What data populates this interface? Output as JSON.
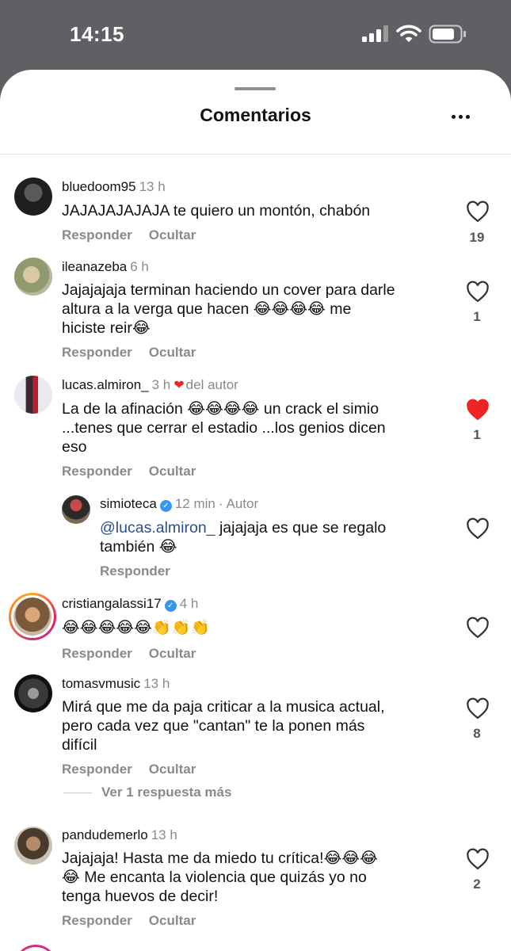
{
  "status_bar": {
    "time": "14:15"
  },
  "sheet": {
    "title": "Comentarios"
  },
  "labels": {
    "reply": "Responder",
    "hide": "Ocultar",
    "by_author": "del autor",
    "author_badge": "Autor"
  },
  "comments": [
    {
      "username": "bluedoom95",
      "time": "13 h",
      "lines": [
        "JAJAJAJAJAJA te quiero un montón, chabón"
      ],
      "likes": "19",
      "liked": false
    },
    {
      "username": "ileanazeba",
      "time": "6 h",
      "lines": [
        "Jajajajaja terminan haciendo un cover para darle",
        "altura a la verga que hacen 😂😂😂😂 me",
        "hiciste reir😂"
      ],
      "likes": "1",
      "liked": false
    },
    {
      "username": "lucas.almiron_",
      "time": "3 h",
      "lines": [
        "La de la afinación 😂😂😂😂 un crack el simio",
        "...tenes que cerrar el estadio ...los genios dicen",
        "eso"
      ],
      "likes": "1",
      "liked": true
    },
    {
      "username": "cristiangalassi17",
      "time": "4 h",
      "lines": [
        "😂😂😂😂😂👏👏👏"
      ],
      "likes": "",
      "liked": false
    },
    {
      "username": "tomasvmusic",
      "time": "13 h",
      "lines": [
        "Mirá que me da paja criticar a la musica actual,",
        "pero cada vez que \"cantan\" te la ponen más",
        "difícil"
      ],
      "likes": "8",
      "liked": false
    },
    {
      "username": "pandudemerlo",
      "time": "13 h",
      "lines": [
        "Jajajaja! Hasta me da miedo tu crítica!😂😂😂",
        "😂 Me encanta la violencia que quizás yo no",
        "tenga huevos de decir!"
      ],
      "likes": "2",
      "liked": false
    }
  ],
  "reply": {
    "username": "simioteca",
    "time": "12 min",
    "mention": "@lucas.almiron_",
    "line1_rest": " jajajaja es que se regalo",
    "line2": "también 😂"
  },
  "view_more": "Ver 1 respuesta más",
  "colors": {
    "like_active": "#ed2424",
    "verified": "#3797f0",
    "muted": "#8a8a8a"
  },
  "icons": {
    "like": "heart-outline-icon",
    "liked": "heart-filled-icon",
    "more": "ellipsis-icon"
  }
}
